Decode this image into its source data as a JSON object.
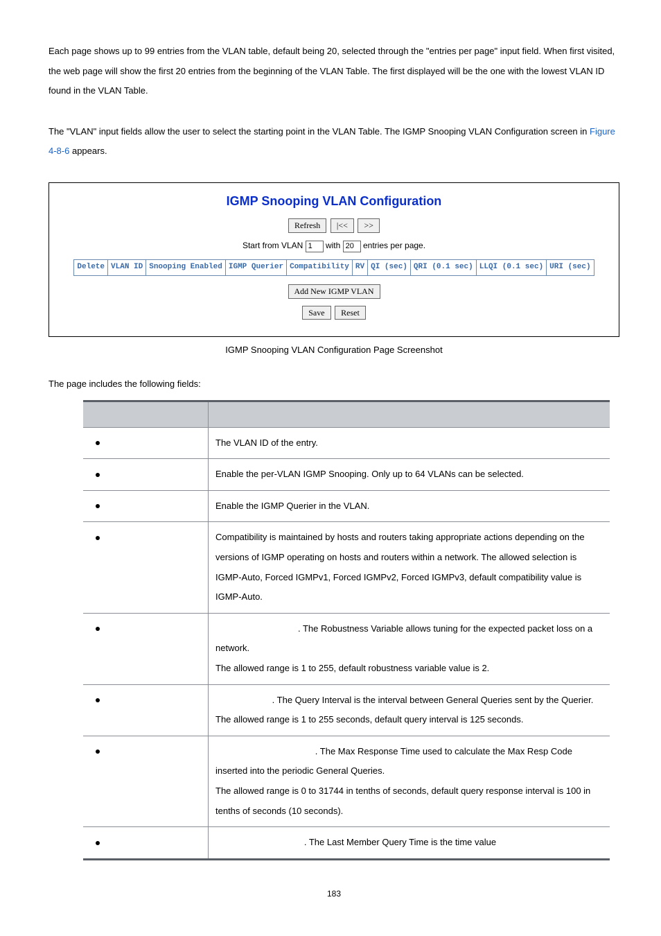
{
  "intro": {
    "p1": "Each page shows up to 99 entries from the VLAN table, default being 20, selected through the \"entries per page\" input field. When first visited, the web page will show the first 20 entries from the beginning of the VLAN Table. The first displayed will be the one with the lowest VLAN ID found in the VLAN Table.",
    "p2a": "The \"VLAN\" input fields allow the user to select the starting point in the VLAN Table. The IGMP Snooping VLAN Configuration screen in ",
    "p2link": "Figure 4-8-6",
    "p2b": " appears."
  },
  "shot": {
    "title": "IGMP Snooping VLAN Configuration",
    "refresh": "Refresh",
    "prev": "|<<",
    "next": ">>",
    "start_pre": "Start from VLAN ",
    "start_val": "1",
    "with": " with ",
    "per_val": "20",
    "start_post": " entries per page.",
    "headers": [
      "Delete",
      "VLAN ID",
      "Snooping Enabled",
      "IGMP Querier",
      "Compatibility",
      "RV",
      "QI (sec)",
      "QRI (0.1 sec)",
      "LLQI (0.1 sec)",
      "URI (sec)"
    ],
    "add": "Add New IGMP VLAN",
    "save": "Save",
    "reset": "Reset"
  },
  "caption": "IGMP Snooping VLAN Configuration Page Screenshot",
  "fields_intro": "The page includes the following fields:",
  "rows": {
    "r0": "The VLAN ID of the entry.",
    "r1": "Enable the per-VLAN IGMP Snooping. Only up to 64 VLANs can be selected.",
    "r2": "Enable the IGMP Querier in the VLAN.",
    "r3": "Compatibility is maintained by hosts and routers taking appropriate actions depending on the versions of IGMP operating on hosts and routers within a network. The allowed selection is IGMP-Auto, Forced IGMPv1, Forced IGMPv2, Forced IGMPv3, default compatibility value is IGMP-Auto.",
    "r4a": ". The Robustness Variable allows tuning for the expected packet loss on a network.",
    "r4b": "The allowed range is 1 to 255, default robustness variable value is 2.",
    "r5a": ". The Query Interval is the interval between General Queries sent by the Querier.",
    "r5b": "The allowed range is 1 to 255 seconds, default query interval is 125 seconds.",
    "r6a": ". The Max Response Time used to calculate the Max Resp Code inserted into the periodic General Queries.",
    "r6b": "The allowed range is 0 to 31744 in tenths of seconds, default query response interval is 100 in tenths of seconds (10 seconds).",
    "r7a": ". The Last Member Query Time is the time value"
  },
  "pagenum": "183"
}
